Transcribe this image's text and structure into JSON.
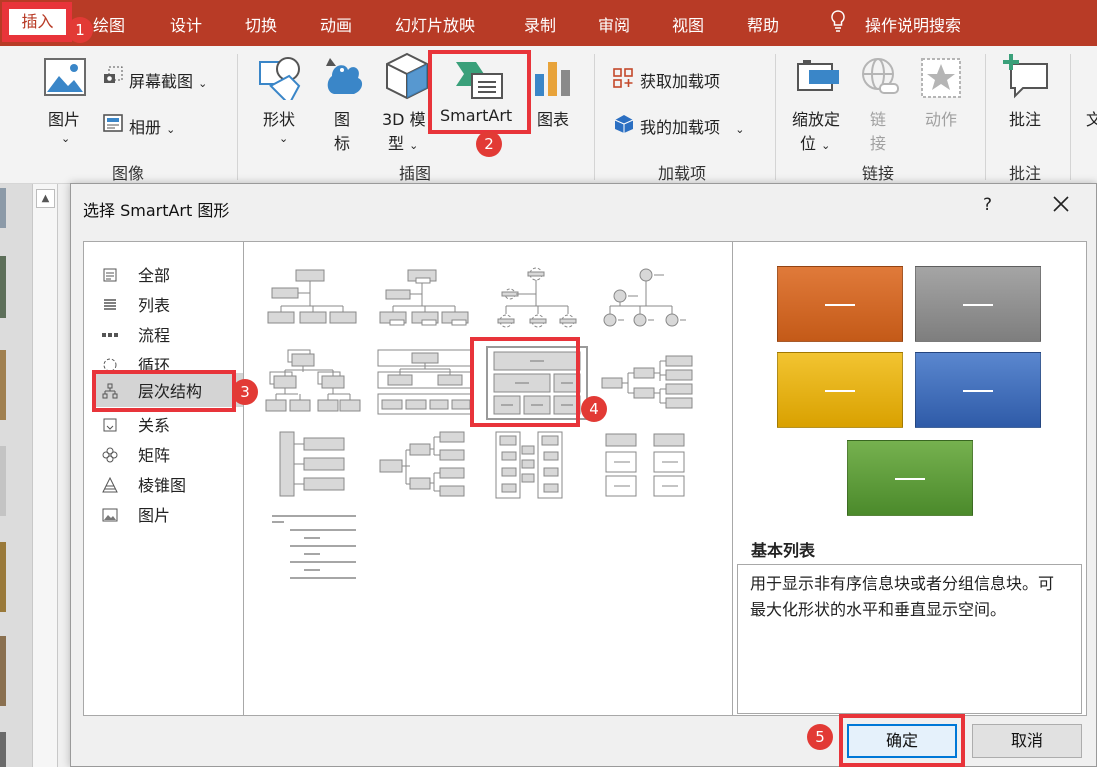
{
  "menubar": {
    "insert_tab": "插入",
    "items": [
      "绘图",
      "设计",
      "切换",
      "动画",
      "幻灯片放映",
      "录制",
      "审阅",
      "视图",
      "帮助"
    ],
    "search": "操作说明搜索"
  },
  "ribbon": {
    "image_group": {
      "label": "图像",
      "picture": "图片",
      "screenshot": "屏幕截图",
      "album": "相册"
    },
    "illustration_group": {
      "label": "插图",
      "shapes": "形状",
      "icons_1": "图",
      "icons_2": "标",
      "model_1": "3D 模",
      "model_2": "型",
      "smartart": "SmartArt",
      "chart": "图表"
    },
    "addins_group": {
      "label": "加载项",
      "get": "获取加载项",
      "mine": "我的加载项"
    },
    "links_group": {
      "label": "链接",
      "zoom_1": "缩放定",
      "zoom_2": "位",
      "link_1": "链",
      "link_2": "接",
      "action": "动作"
    },
    "comments_group": {
      "label": "批注",
      "comment": "批注",
      "text_partial": "文"
    }
  },
  "dialog": {
    "title": "选择 SmartArt 图形",
    "help": "?",
    "categories": [
      "全部",
      "列表",
      "流程",
      "循环",
      "层次结构",
      "关系",
      "矩阵",
      "棱锥图",
      "图片"
    ],
    "selected_category": "层次结构",
    "preview": {
      "name": "基本列表",
      "description": "用于显示非有序信息块或者分组信息块。可最大化形状的水平和垂直显示空间。",
      "colors": [
        "#d4641e",
        "#8a8a8a",
        "#e9b100",
        "#3d6db8",
        "#5e9d3c"
      ]
    },
    "ok": "确定",
    "cancel": "取消"
  },
  "callouts": [
    "1",
    "2",
    "3",
    "4",
    "5"
  ]
}
